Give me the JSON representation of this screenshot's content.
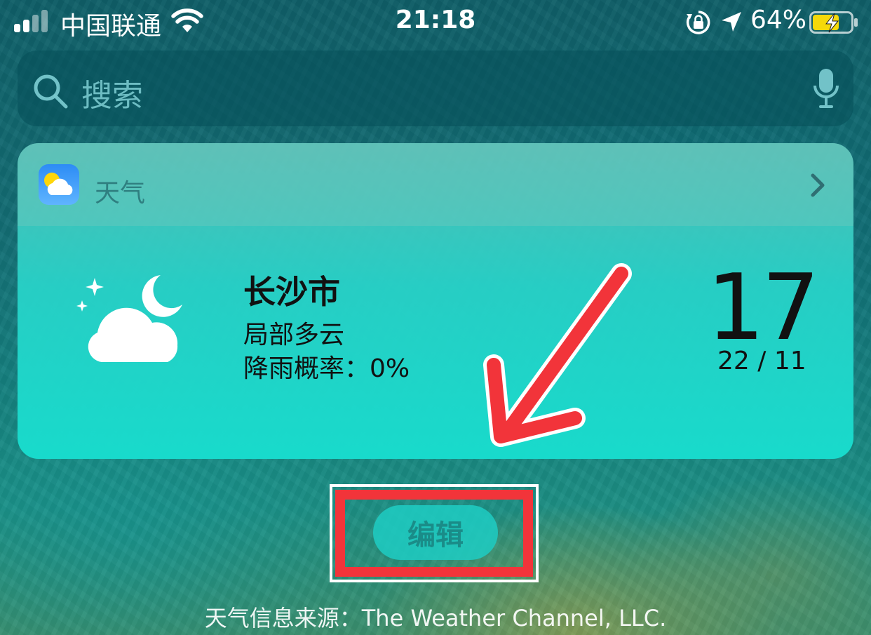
{
  "status_bar": {
    "carrier": "中国联通",
    "time": "21:18",
    "battery_percent": "64%",
    "icons": [
      "signal-icon",
      "wifi-icon",
      "rotation-lock-icon",
      "location-icon",
      "battery-charging-icon"
    ]
  },
  "search": {
    "placeholder": "搜索",
    "icons": [
      "search-icon",
      "microphone-icon"
    ]
  },
  "weather_widget": {
    "app_name": "天气",
    "city": "长沙市",
    "condition": "局部多云",
    "rain_chance": "降雨概率：0%",
    "temperature": "17",
    "high_low": "22 / 11",
    "icons": [
      "weather-app-icon",
      "chevron-right-icon",
      "partly-cloudy-night-icon"
    ]
  },
  "edit_button": {
    "label": "编辑"
  },
  "footer": {
    "source": "天气信息来源：The Weather Channel, LLC."
  },
  "annotation": {
    "arrow_color": "#f2343a",
    "box_color": "#f2343a"
  }
}
